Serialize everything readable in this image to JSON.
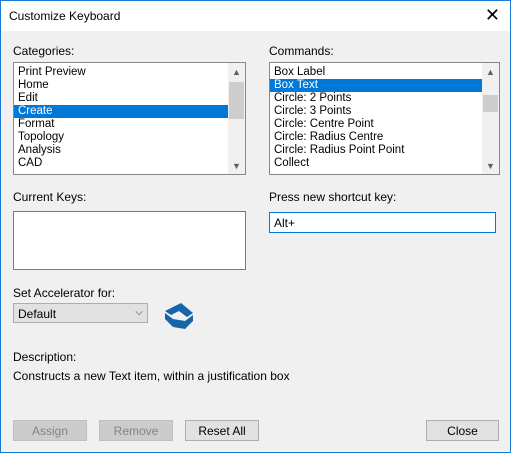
{
  "window": {
    "title": "Customize Keyboard",
    "close_glyph": "✕"
  },
  "categories": {
    "label": "Categories:",
    "items": [
      "Print Preview",
      "Home",
      "Edit",
      "Create",
      "Format",
      "Topology",
      "Analysis",
      "CAD"
    ],
    "selected": "Create"
  },
  "commands": {
    "label": "Commands:",
    "items": [
      "Box Label",
      "Box Text",
      "Circle: 2 Points",
      "Circle: 3 Points",
      "Circle: Centre Point",
      "Circle: Radius Centre",
      "Circle: Radius Point Point",
      "Collect"
    ],
    "selected": "Box Text"
  },
  "current_keys": {
    "label": "Current Keys:"
  },
  "shortcut": {
    "label": "Press new shortcut key:",
    "value": "Alt+"
  },
  "accelerator": {
    "label": "Set Accelerator for:",
    "selected": "Default"
  },
  "description": {
    "label": "Description:",
    "text": "Constructs a new Text item, within a justification box"
  },
  "buttons": {
    "assign": "Assign",
    "remove": "Remove",
    "reset_all": "Reset All",
    "close": "Close"
  },
  "icons": {
    "app_logo": "app-logo-icon",
    "close": "close-icon",
    "scroll_up": "scroll-up-arrow-icon",
    "scroll_down": "scroll-down-arrow-icon",
    "combo_arrow": "chevron-down-icon"
  },
  "colors": {
    "selection": "#0078d7",
    "logo": "#1565a8",
    "focus_border": "#0078d7"
  }
}
